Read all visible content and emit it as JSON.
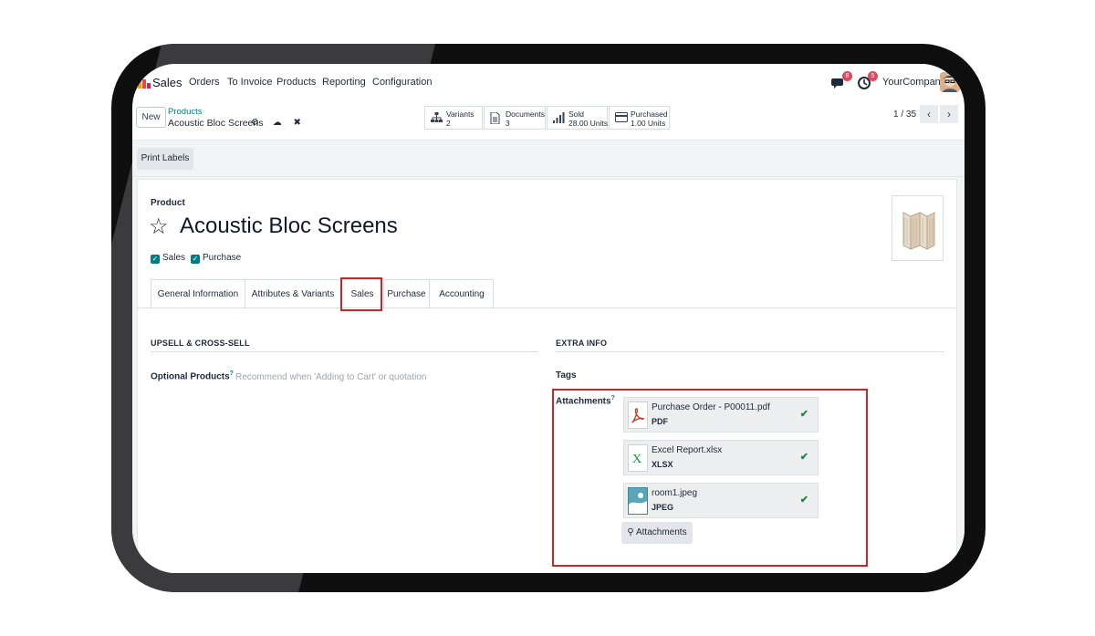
{
  "nav": {
    "app": "Sales",
    "items": [
      "Orders",
      "To Invoice",
      "Products",
      "Reporting",
      "Configuration"
    ],
    "messages_count": "8",
    "activities_count": "5",
    "company": "YourCompany"
  },
  "control": {
    "new_label": "New",
    "breadcrumb_parent": "Products",
    "breadcrumb_current": "Acoustic Bloc Screens",
    "smart_buttons": [
      {
        "icon": "sitemap-icon",
        "label": "Variants",
        "value": "2"
      },
      {
        "icon": "document-icon",
        "label": "Documents",
        "value": "3"
      },
      {
        "icon": "bar-chart-icon",
        "label": "Sold",
        "value": "28.00 Units"
      },
      {
        "icon": "credit-card-icon",
        "label": "Purchased",
        "value": "1.00 Units"
      }
    ],
    "pager": "1 / 35"
  },
  "actions": {
    "print_labels": "Print Labels"
  },
  "form": {
    "product_label": "Product",
    "title": "Acoustic Bloc Screens",
    "checkboxes": [
      {
        "label": "Sales",
        "checked": true
      },
      {
        "label": "Purchase",
        "checked": true
      }
    ],
    "tabs": [
      "General Information",
      "Attributes & Variants",
      "Sales",
      "Purchase",
      "Accounting"
    ],
    "active_tab": "Sales",
    "upsell_title": "UPSELL & CROSS-SELL",
    "optional_products_label": "Optional Products",
    "optional_products_placeholder": "Recommend when 'Adding to Cart' or quotation",
    "extra_info_title": "EXTRA INFO",
    "tags_label": "Tags",
    "attachments_label": "Attachments",
    "help_mark": "?",
    "attachments": [
      {
        "name": "Purchase Order - P00011.pdf",
        "type": "PDF",
        "icon": "pdf-icon"
      },
      {
        "name": "Excel Report.xlsx",
        "type": "XLSX",
        "icon": "excel-icon"
      },
      {
        "name": "room1.jpeg",
        "type": "JPEG",
        "icon": "image-icon"
      }
    ],
    "attachments_button": "Attachments"
  }
}
